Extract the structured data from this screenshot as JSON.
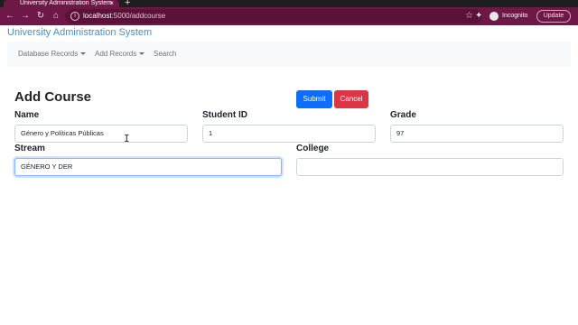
{
  "browser": {
    "tab_title": "University Administration System",
    "tab_close": "×",
    "new_tab": "+",
    "back_icon": "←",
    "forward_icon": "→",
    "reload_icon": "↻",
    "home_icon": "⌂",
    "url_host": "localhost",
    "url_path": ":5000/addcourse",
    "star_icon": "☆",
    "extensions_icon": "✦",
    "incognito_label": "Incognito",
    "update_label": "Update"
  },
  "navbar": {
    "brand": "University Administration System",
    "items": [
      {
        "label": "Database Records",
        "dropdown": true
      },
      {
        "label": "Add Records",
        "dropdown": true
      },
      {
        "label": "Search",
        "dropdown": false
      }
    ]
  },
  "form": {
    "title": "Add Course",
    "submit_label": "Submit",
    "cancel_label": "Cancel",
    "fields": {
      "name": {
        "label": "Name",
        "value": "Género y Políticas Públicas"
      },
      "student_id": {
        "label": "Student ID",
        "value": "1"
      },
      "grade": {
        "label": "Grade",
        "value": "97"
      },
      "stream": {
        "label": "Stream",
        "value": "GÉNERO Y DER"
      },
      "college": {
        "label": "College",
        "value": ""
      }
    }
  },
  "colors": {
    "chrome": "#6d1846",
    "brand": "#4b8fc6",
    "primary": "#0d6efd",
    "danger": "#dc3545"
  }
}
